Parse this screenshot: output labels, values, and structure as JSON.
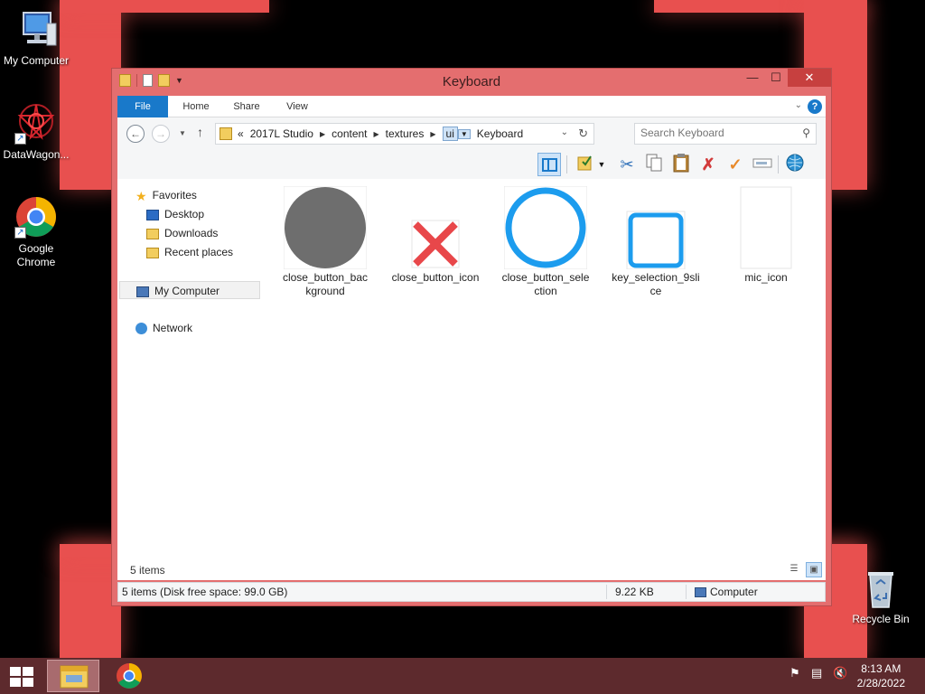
{
  "desktop": {
    "icons": [
      {
        "label": "My Computer",
        "icon": "computer-icon"
      },
      {
        "label": "DataWagon...",
        "icon": "datawagon-icon"
      },
      {
        "label": "Google Chrome",
        "icon": "chrome-icon"
      },
      {
        "label": "Recycle Bin",
        "icon": "recycle-bin-icon"
      }
    ]
  },
  "window": {
    "title": "Keyboard",
    "controls": {
      "minimize": "—",
      "maximize": "☐",
      "close": "✕"
    },
    "ribbon": {
      "tabs": [
        "File",
        "Home",
        "Share",
        "View"
      ],
      "help": "?"
    },
    "address": {
      "overflow": "«",
      "crumbs": [
        "2017L Studio",
        "content",
        "textures",
        "ui",
        "Keyboard"
      ]
    },
    "search": {
      "placeholder": "Search Keyboard"
    },
    "nav_pane": {
      "favorites": "Favorites",
      "favorites_items": [
        "Desktop",
        "Downloads",
        "Recent places"
      ],
      "computer": "My Computer",
      "network": "Network"
    },
    "files": [
      {
        "name": "close_button_background",
        "thumb": "gray-circle"
      },
      {
        "name": "close_button_icon",
        "thumb": "red-x"
      },
      {
        "name": "close_button_selection",
        "thumb": "blue-ring"
      },
      {
        "name": "key_selection_9slice",
        "thumb": "blue-rounded-square"
      },
      {
        "name": "mic_icon",
        "thumb": "white-blank"
      }
    ],
    "item_count": "5 items",
    "status": {
      "left": "5 items (Disk free space: 99.0 GB)",
      "size": "9.22 KB",
      "location": "Computer"
    }
  },
  "taskbar": {
    "time": "8:13 AM",
    "date": "2/28/2022"
  },
  "colors": {
    "titlebar": "#e46e6f",
    "accent": "#1979ca",
    "taskbar": "#5d2a2d",
    "wallpaper_red": "#e8504f"
  }
}
